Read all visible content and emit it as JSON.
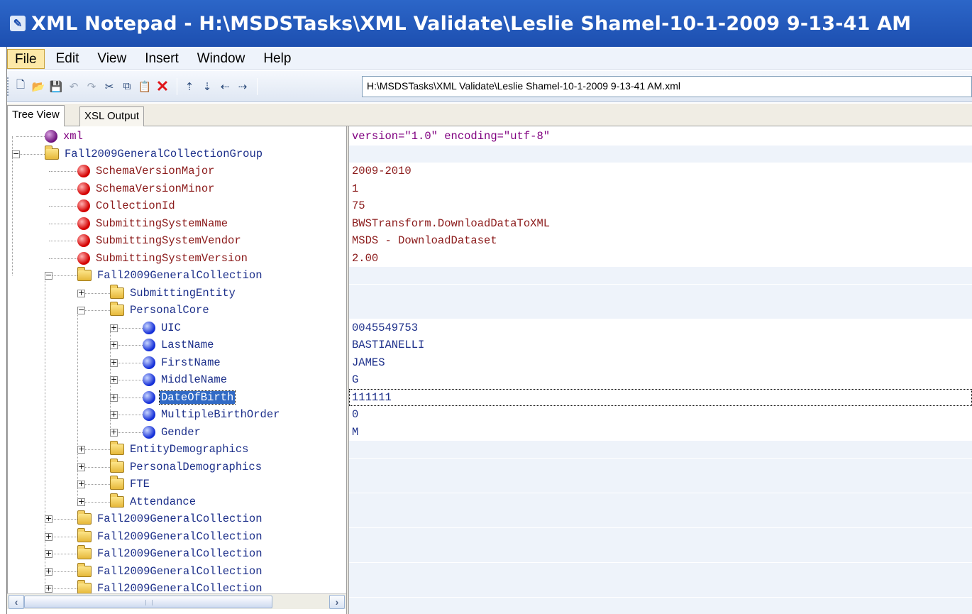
{
  "window": {
    "title": "XML Notepad - H:\\MSDSTasks\\XML Validate\\Leslie Shamel-10-1-2009 9-13-41 AM"
  },
  "menu": [
    {
      "label": "File",
      "active": true
    },
    {
      "label": "Edit"
    },
    {
      "label": "View"
    },
    {
      "label": "Insert"
    },
    {
      "label": "Window"
    },
    {
      "label": "Help"
    }
  ],
  "toolbar": {
    "buttons": [
      {
        "name": "new-icon",
        "glyph": "🗋"
      },
      {
        "name": "open-icon",
        "glyph": "📂"
      },
      {
        "name": "save-icon",
        "glyph": "💾"
      },
      {
        "name": "undo-icon",
        "glyph": "↶"
      },
      {
        "name": "redo-icon",
        "glyph": "↷"
      },
      {
        "name": "cut-icon",
        "glyph": "✂"
      },
      {
        "name": "copy-icon",
        "glyph": "⧉"
      },
      {
        "name": "paste-icon",
        "glyph": "📋"
      },
      {
        "name": "delete-icon",
        "glyph": "✕"
      },
      {
        "name": "nudge-up-icon",
        "glyph": "⇡"
      },
      {
        "name": "nudge-down-icon",
        "glyph": "⇣"
      },
      {
        "name": "nudge-left-icon",
        "glyph": "⇠"
      },
      {
        "name": "nudge-right-icon",
        "glyph": "⇢"
      }
    ],
    "location": "H:\\MSDSTasks\\XML Validate\\Leslie Shamel-10-1-2009 9-13-41 AM.xml"
  },
  "tabs": [
    {
      "label": "Tree View",
      "selected": true
    },
    {
      "label": "XSL Output",
      "selected": false
    }
  ],
  "tree": [
    {
      "label": "xml",
      "kind": "pi",
      "icon": "ball-purple-icon",
      "value": "version=\"1.0\" encoding=\"utf-8\""
    },
    {
      "label": "Fall2009GeneralCollectionGroup",
      "kind": "container",
      "icon": "folder-icon",
      "expander": "minus",
      "value": ""
    },
    {
      "label": "SchemaVersionMajor",
      "kind": "elem",
      "icon": "ball-red-icon",
      "value": "2009-2010"
    },
    {
      "label": "SchemaVersionMinor",
      "kind": "elem",
      "icon": "ball-red-icon",
      "value": "1"
    },
    {
      "label": "CollectionId",
      "kind": "elem",
      "icon": "ball-red-icon",
      "value": "75"
    },
    {
      "label": "SubmittingSystemName",
      "kind": "elem",
      "icon": "ball-red-icon",
      "value": "BWSTransform.DownloadDataToXML"
    },
    {
      "label": "SubmittingSystemVendor",
      "kind": "elem",
      "icon": "ball-red-icon",
      "value": "MSDS - DownloadDataset"
    },
    {
      "label": "SubmittingSystemVersion",
      "kind": "elem",
      "icon": "ball-red-icon",
      "value": "2.00"
    },
    {
      "label": "Fall2009GeneralCollection",
      "kind": "container",
      "icon": "folder-icon",
      "expander": "minus",
      "value": ""
    },
    {
      "label": "SubmittingEntity",
      "kind": "container",
      "icon": "folder-icon",
      "expander": "plus",
      "value": ""
    },
    {
      "label": "PersonalCore",
      "kind": "container",
      "icon": "folder-icon",
      "expander": "minus",
      "value": ""
    },
    {
      "label": "UIC",
      "kind": "attr",
      "icon": "ball-blue-icon",
      "expander": "plus",
      "value": "0045549753"
    },
    {
      "label": "LastName",
      "kind": "attr",
      "icon": "ball-blue-icon",
      "expander": "plus",
      "value": "BASTIANELLI"
    },
    {
      "label": "FirstName",
      "kind": "attr",
      "icon": "ball-blue-icon",
      "expander": "plus",
      "value": "JAMES"
    },
    {
      "label": "MiddleName",
      "kind": "attr",
      "icon": "ball-blue-icon",
      "expander": "plus",
      "value": "G"
    },
    {
      "label": "DateOfBirth",
      "kind": "attr",
      "icon": "ball-blue-icon",
      "expander": "plus",
      "value": "111111",
      "selected": true
    },
    {
      "label": "MultipleBirthOrder",
      "kind": "attr",
      "icon": "ball-blue-icon",
      "expander": "plus",
      "value": "0"
    },
    {
      "label": "Gender",
      "kind": "attr",
      "icon": "ball-blue-icon",
      "expander": "plus",
      "value": "M"
    },
    {
      "label": "EntityDemographics",
      "kind": "container",
      "icon": "folder-icon",
      "expander": "plus",
      "value": ""
    },
    {
      "label": "PersonalDemographics",
      "kind": "container",
      "icon": "folder-icon",
      "expander": "plus",
      "value": ""
    },
    {
      "label": "FTE",
      "kind": "container",
      "icon": "folder-icon",
      "expander": "plus",
      "value": ""
    },
    {
      "label": "Attendance",
      "kind": "container",
      "icon": "folder-icon",
      "expander": "plus",
      "value": ""
    },
    {
      "label": "Fall2009GeneralCollection",
      "kind": "container",
      "icon": "folder-icon",
      "expander": "plus",
      "value": ""
    },
    {
      "label": "Fall2009GeneralCollection",
      "kind": "container",
      "icon": "folder-icon",
      "expander": "plus",
      "value": ""
    },
    {
      "label": "Fall2009GeneralCollection",
      "kind": "container",
      "icon": "folder-icon",
      "expander": "plus",
      "value": ""
    },
    {
      "label": "Fall2009GeneralCollection",
      "kind": "container",
      "icon": "folder-icon",
      "expander": "plus",
      "value": ""
    },
    {
      "label": "Fall2009GeneralCollection",
      "kind": "container",
      "icon": "folder-icon",
      "expander": "plus",
      "value": ""
    }
  ],
  "colors": {
    "title_bar": "#2c66c8",
    "selection": "#316ac5",
    "value_row_shade": "#eef3fa"
  }
}
